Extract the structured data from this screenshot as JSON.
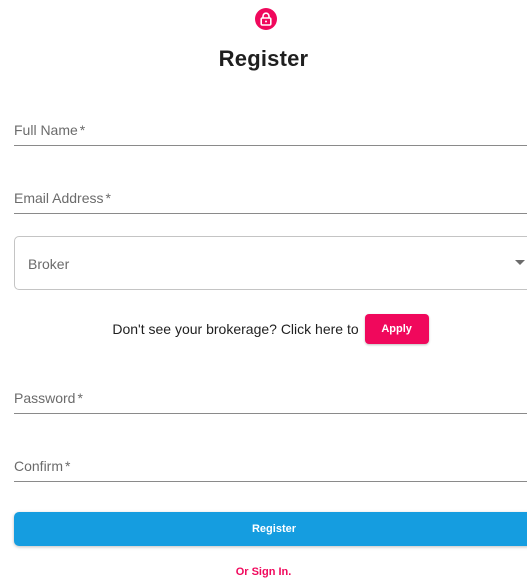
{
  "header": {
    "icon": "lock-icon",
    "title": "Register"
  },
  "form": {
    "full_name": {
      "label": "Full Name",
      "required_mark": "*",
      "value": ""
    },
    "email": {
      "label": "Email Address",
      "required_mark": "*",
      "value": ""
    },
    "broker": {
      "label": "Broker",
      "selected": ""
    },
    "apply_prompt": "Don't see your brokerage? Click here to",
    "apply_label": "Apply",
    "password": {
      "label": "Password",
      "required_mark": "*",
      "value": ""
    },
    "confirm": {
      "label": "Confirm",
      "required_mark": "*",
      "value": ""
    },
    "submit_label": "Register",
    "signin_label": "Or Sign In."
  },
  "colors": {
    "accent": "#f0085c",
    "primary": "#159de0",
    "text": "#1f1f1f",
    "muted": "#6b6b6b"
  }
}
